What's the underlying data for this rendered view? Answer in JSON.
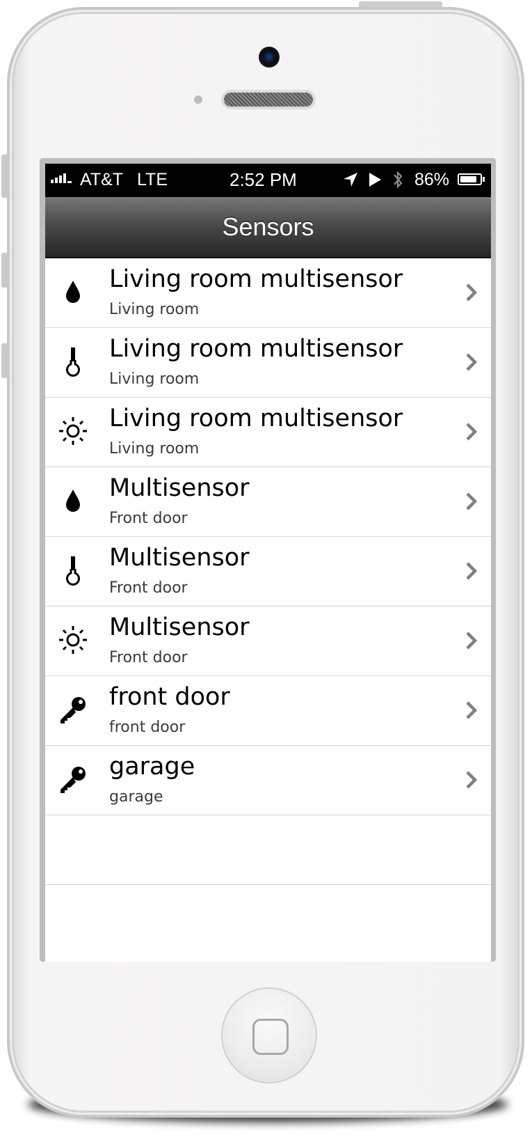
{
  "status_bar": {
    "carrier": "AT&T",
    "network": "LTE",
    "time": "2:52 PM",
    "battery_percent": "86%",
    "battery_level": 0.86,
    "icons": [
      "signal-icon",
      "location-arrow-icon",
      "play-icon",
      "bluetooth-icon",
      "battery-icon"
    ]
  },
  "nav": {
    "title": "Sensors"
  },
  "sensors": [
    {
      "title": "Living room multisensor",
      "subtitle": "Living room",
      "icon": "humidity-drop-icon"
    },
    {
      "title": "Living room multisensor",
      "subtitle": "Living room",
      "icon": "thermometer-icon"
    },
    {
      "title": "Living room multisensor",
      "subtitle": "Living room",
      "icon": "sun-light-icon"
    },
    {
      "title": "Multisensor",
      "subtitle": "Front door",
      "icon": "humidity-drop-icon"
    },
    {
      "title": "Multisensor",
      "subtitle": "Front door",
      "icon": "thermometer-icon"
    },
    {
      "title": "Multisensor",
      "subtitle": "Front door",
      "icon": "sun-light-icon"
    },
    {
      "title": "front door",
      "subtitle": "front door",
      "icon": "key-icon"
    },
    {
      "title": "garage",
      "subtitle": "garage",
      "icon": "key-icon"
    }
  ],
  "colors": {
    "status_bar_bg": "#000000",
    "nav_gradient_top": "#777777",
    "nav_gradient_bottom": "#262626",
    "row_separator": "#d6d6d6",
    "chevron": "#808080"
  }
}
